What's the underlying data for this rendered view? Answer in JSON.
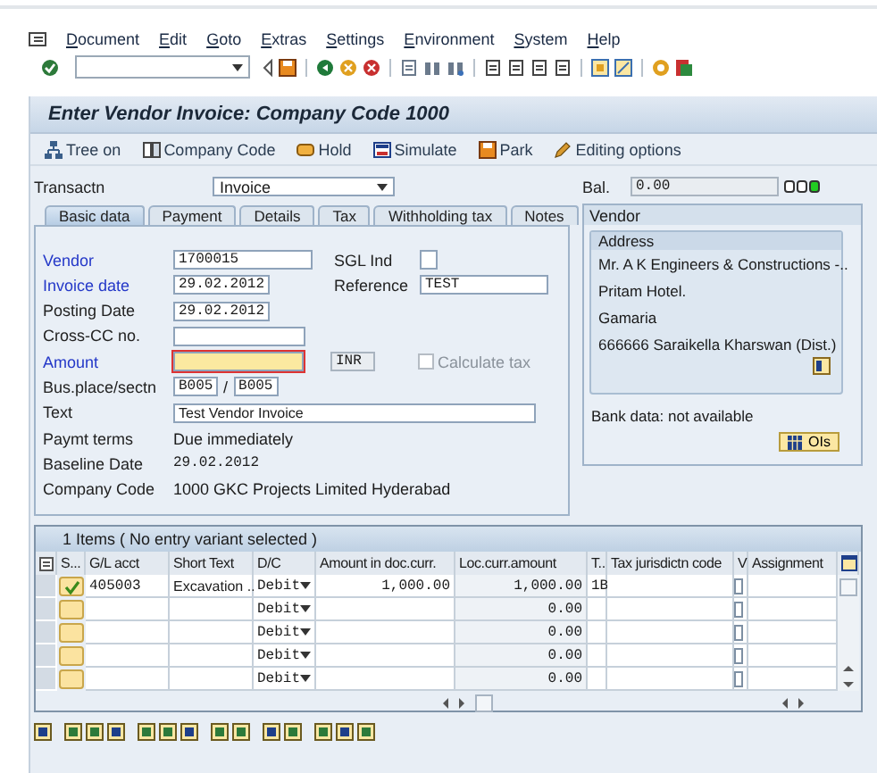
{
  "menu": [
    "Document",
    "Edit",
    "Goto",
    "Extras",
    "Settings",
    "Environment",
    "System",
    "Help"
  ],
  "title": "Enter Vendor Invoice: Company Code 1000",
  "app_toolbar": [
    "Tree on",
    "Company Code",
    "Hold",
    "Simulate",
    "Park",
    "Editing options"
  ],
  "transaction": {
    "label": "Transactn",
    "value": "Invoice"
  },
  "balance": {
    "label": "Bal.",
    "value": "0.00",
    "balanced": true
  },
  "tabs": [
    {
      "label": "Basic data",
      "selected": true
    },
    {
      "label": "Payment",
      "selected": false
    },
    {
      "label": "Details",
      "selected": false
    },
    {
      "label": "Tax",
      "selected": false
    },
    {
      "label": "Withholding tax",
      "selected": false
    },
    {
      "label": "Notes",
      "selected": false
    }
  ],
  "form": {
    "vendor": {
      "label": "Vendor",
      "required": true,
      "value": "1700015"
    },
    "sgl_ind": {
      "label": "SGL Ind"
    },
    "invoice_date": {
      "label": "Invoice date",
      "required": true,
      "value": "29.02.2012"
    },
    "reference": {
      "label": "Reference",
      "value": "TEST"
    },
    "posting_date": {
      "label": "Posting Date",
      "required": false,
      "value": "29.02.2012"
    },
    "cross_cc": {
      "label": "Cross-CC no.",
      "required": false
    },
    "amount": {
      "label": "Amount",
      "required": true,
      "focused": true
    },
    "currency": {
      "value": "INR"
    },
    "calculate_tax": {
      "label": "Calculate tax",
      "checked": false,
      "disabled": true
    },
    "bus_place": {
      "label": "Bus.place/sectn",
      "required": false,
      "value": "B005",
      "separator": "/",
      "section": "B005"
    },
    "text": {
      "label": "Text",
      "required": false,
      "value": "Test Vendor Invoice"
    },
    "payment_terms": {
      "label": "Paymt terms",
      "required": false,
      "value": "Due immediately"
    },
    "baseline_date": {
      "label": "Baseline Date",
      "required": false,
      "value": "29.02.2012"
    },
    "company_code": {
      "label": "Company Code",
      "required": false,
      "value": "1000 GKC Projects Limited Hyderabad"
    }
  },
  "vendor_panel": {
    "title": "Vendor",
    "address_title": "Address",
    "address_lines": [
      "Mr. A K Engineers & Constructions -..",
      "Pritam Hotel.",
      "Gamaria",
      "666666 Saraikella Kharswan (Dist.)"
    ],
    "bank_data": "Bank data: not available",
    "ois_button": "OIs"
  },
  "items": {
    "header": "1 Items ( No entry variant selected )",
    "columns": [
      "S...",
      "G/L acct",
      "Short Text",
      "D/C",
      "Amount in doc.curr.",
      "Loc.curr.amount",
      "T..",
      "Tax jurisdictn code",
      "V",
      "Assignment"
    ],
    "rows": [
      {
        "ok": true,
        "gl_acct": "405003",
        "short_text": "Excavation ..",
        "dc": "Debit",
        "amount_doc": "1,000.00",
        "amount_loc": "1,000.00",
        "tax_code": "1B",
        "v_checked": false
      },
      {
        "ok": false,
        "dc": "Debit",
        "amount_loc": "0.00",
        "v_checked": false
      },
      {
        "ok": false,
        "dc": "Debit",
        "amount_loc": "0.00",
        "v_checked": false
      },
      {
        "ok": false,
        "dc": "Debit",
        "amount_loc": "0.00",
        "v_checked": false
      },
      {
        "ok": false,
        "dc": "Debit",
        "amount_loc": "0.00",
        "v_checked": false
      }
    ]
  }
}
